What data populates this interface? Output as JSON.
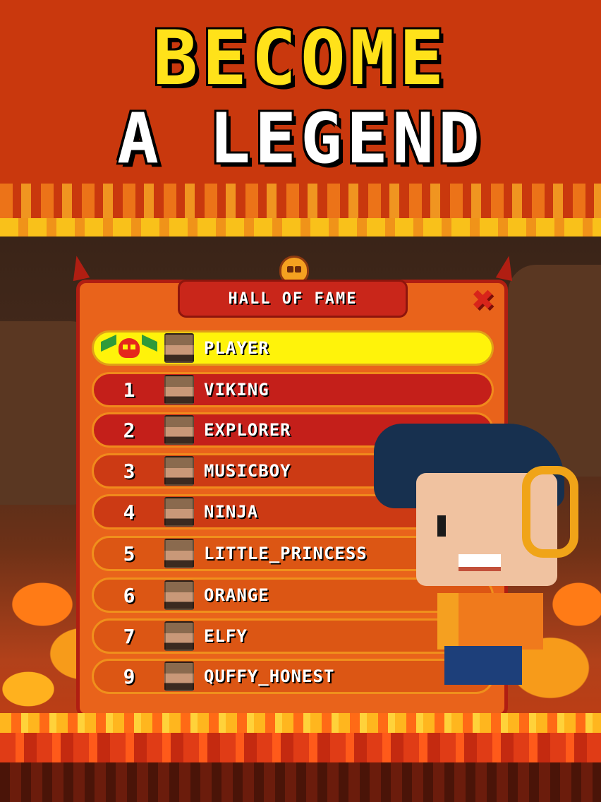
{
  "banner": {
    "line1": "BECOME",
    "line2": "A LEGEND"
  },
  "leaderboard": {
    "title": "HALL OF FAME",
    "close_icon": "close-x-icon",
    "player": {
      "name": "PLAYER"
    },
    "entries": [
      {
        "rank": "1",
        "name": "VIKING"
      },
      {
        "rank": "2",
        "name": "EXPLORER"
      },
      {
        "rank": "3",
        "name": "MUSICBOY"
      },
      {
        "rank": "4",
        "name": "NINJA"
      },
      {
        "rank": "5",
        "name": "LITTLE_PRINCESS"
      },
      {
        "rank": "6",
        "name": "ORANGE"
      },
      {
        "rank": "7",
        "name": "ELFY"
      },
      {
        "rank": "9",
        "name": "QUFFY_HONEST"
      }
    ]
  },
  "colors": {
    "title_yellow": "#ffe21a",
    "banner_red": "#c9380d",
    "panel_orange": "#e9631b",
    "player_row": "#fff30a",
    "top_row": "#c41f1a"
  }
}
